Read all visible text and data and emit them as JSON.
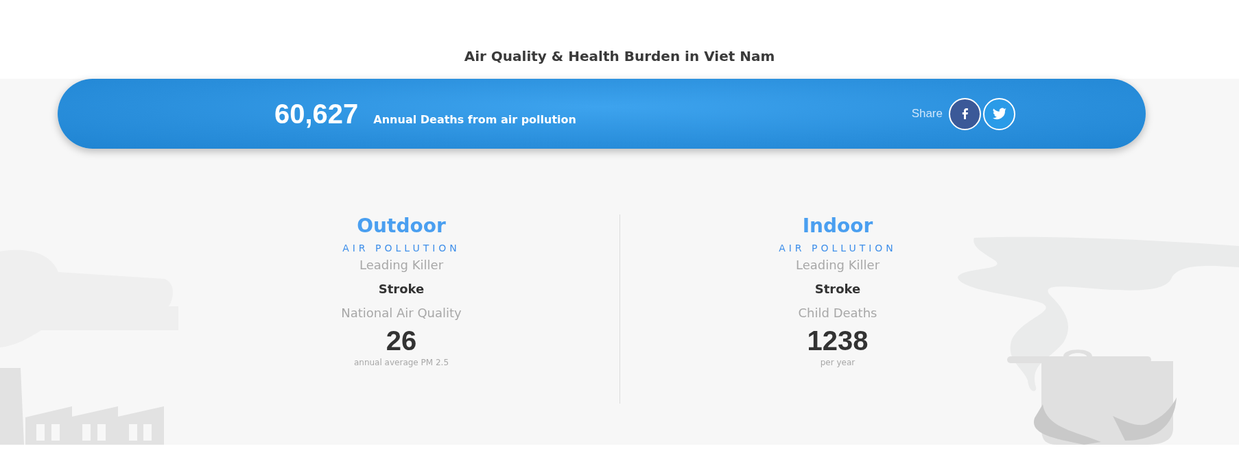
{
  "page_title": "Air Quality & Health Burden in Viet Nam",
  "banner": {
    "count": "60,627",
    "label": "Annual Deaths from air pollution",
    "share_label": "Share"
  },
  "panels": [
    {
      "title": "Outdoor",
      "subtitle": "AIR POLLUTION",
      "killer_label": "Leading Killer",
      "killer": "Stroke",
      "stat_label": "National Air Quality",
      "stat_value": "26",
      "stat_unit": "annual average PM 2.5"
    },
    {
      "title": "Indoor",
      "subtitle": "AIR POLLUTION",
      "killer_label": "Leading Killer",
      "killer": "Stroke",
      "stat_label": "Child Deaths",
      "stat_value": "1238",
      "stat_unit": "per year"
    }
  ]
}
